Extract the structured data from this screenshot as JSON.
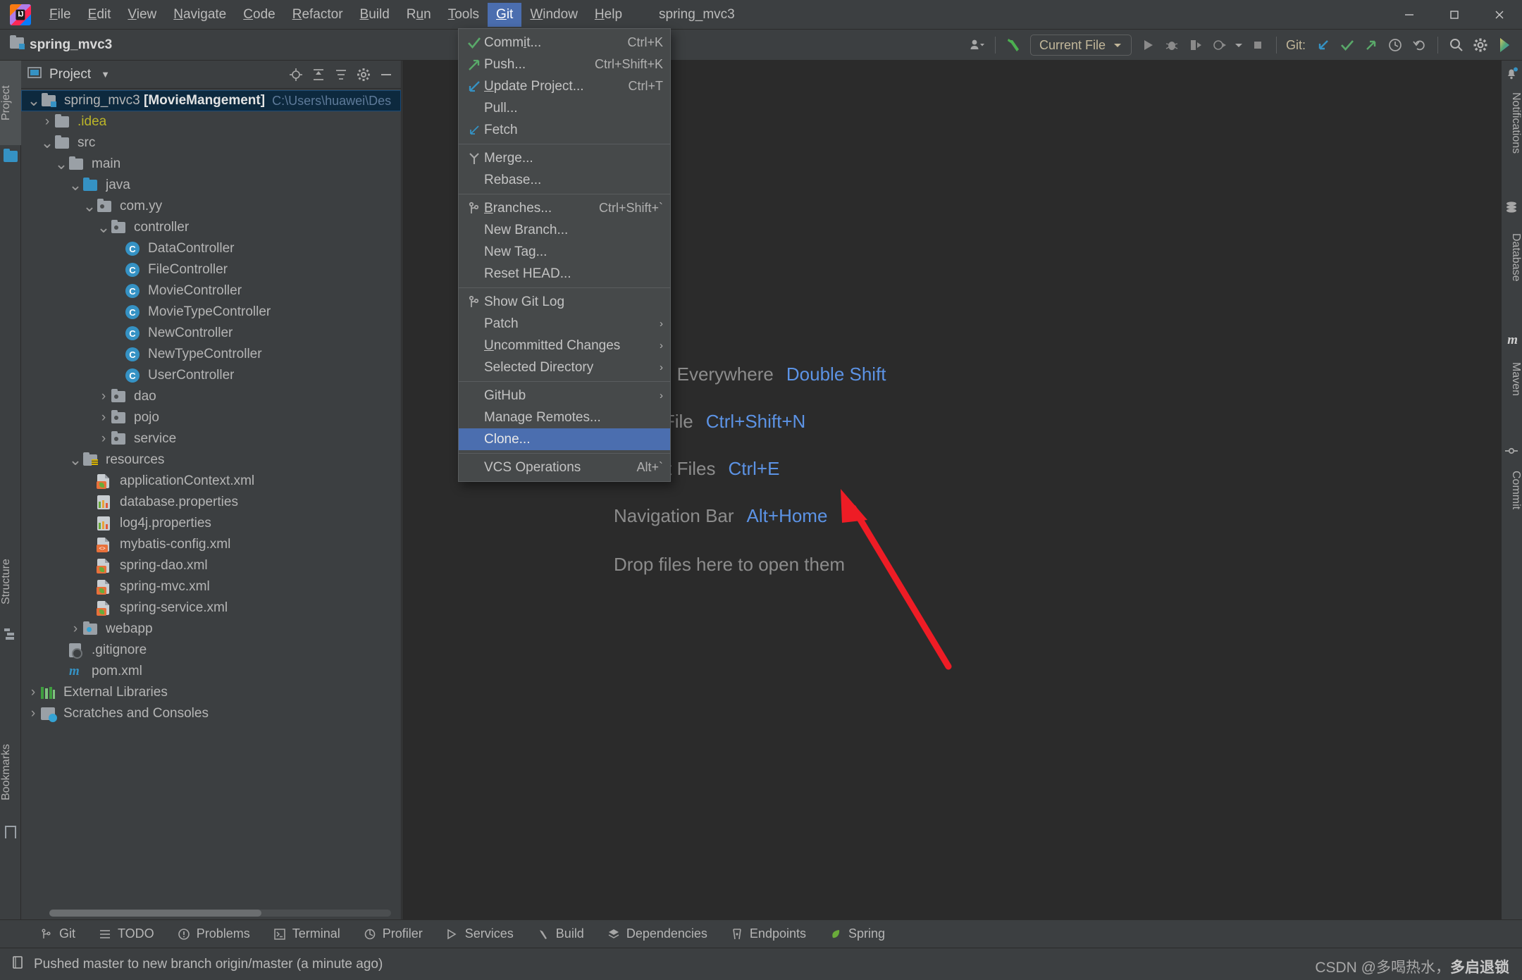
{
  "window": {
    "title": "spring_mvc3",
    "controls": {
      "minimize": "—",
      "maximize": "❐",
      "close": "✕"
    }
  },
  "menubar": {
    "items": [
      {
        "label": "File",
        "mnemonic": "F"
      },
      {
        "label": "Edit",
        "mnemonic": "E"
      },
      {
        "label": "View",
        "mnemonic": "V"
      },
      {
        "label": "Navigate",
        "mnemonic": "N"
      },
      {
        "label": "Code",
        "mnemonic": "C"
      },
      {
        "label": "Refactor",
        "mnemonic": "R"
      },
      {
        "label": "Build",
        "mnemonic": "B"
      },
      {
        "label": "Run",
        "mnemonic": "u"
      },
      {
        "label": "Tools",
        "mnemonic": "T"
      },
      {
        "label": "Git",
        "mnemonic": "G",
        "active": true
      },
      {
        "label": "Window",
        "mnemonic": "W"
      },
      {
        "label": "Help",
        "mnemonic": "H"
      }
    ]
  },
  "navbar": {
    "breadcrumb": "spring_mvc3",
    "run_config": "Current File",
    "git_label": "Git:"
  },
  "git_menu": {
    "items": [
      {
        "label": "Commit...",
        "mnemonic": "i",
        "shortcut": "Ctrl+K",
        "icon": "check-icon"
      },
      {
        "label": "Push...",
        "shortcut": "Ctrl+Shift+K",
        "icon": "arrow-up-right-icon"
      },
      {
        "label": "Update Project...",
        "mnemonic": "U",
        "shortcut": "Ctrl+T",
        "icon": "arrow-down-left-icon"
      },
      {
        "label": "Pull...",
        "shortcut": "",
        "icon": ""
      },
      {
        "label": "Fetch",
        "shortcut": "",
        "icon": "fetch-icon"
      },
      {
        "separator": true
      },
      {
        "label": "Merge...",
        "shortcut": "",
        "icon": "merge-icon"
      },
      {
        "label": "Rebase...",
        "shortcut": "",
        "icon": ""
      },
      {
        "separator": true
      },
      {
        "label": "Branches...",
        "mnemonic": "B",
        "shortcut": "Ctrl+Shift+`",
        "icon": "branch-icon"
      },
      {
        "label": "New Branch...",
        "shortcut": "",
        "icon": ""
      },
      {
        "label": "New Tag...",
        "shortcut": "",
        "icon": ""
      },
      {
        "label": "Reset HEAD...",
        "shortcut": "",
        "icon": ""
      },
      {
        "separator": true
      },
      {
        "label": "Show Git Log",
        "shortcut": "",
        "icon": "branch-icon"
      },
      {
        "label": "Patch",
        "shortcut": "",
        "icon": "",
        "submenu": true
      },
      {
        "label": "Uncommitted Changes",
        "mnemonic": "U",
        "shortcut": "",
        "icon": "",
        "submenu": true
      },
      {
        "label": "Selected Directory",
        "shortcut": "",
        "icon": "",
        "submenu": true
      },
      {
        "separator": true
      },
      {
        "label": "GitHub",
        "shortcut": "",
        "icon": "",
        "submenu": true
      },
      {
        "label": "Manage Remotes...",
        "shortcut": "",
        "icon": ""
      },
      {
        "label": "Clone...",
        "shortcut": "",
        "icon": "",
        "highlighted": true
      },
      {
        "separator": true
      },
      {
        "label": "VCS Operations",
        "shortcut": "Alt+`",
        "icon": ""
      }
    ]
  },
  "project_panel": {
    "title": "Project",
    "tree": [
      {
        "depth": 0,
        "arrow": "down",
        "icon": "module-folder-icon",
        "label": "spring_mvc3 ",
        "bold": "[MovieMangement]",
        "path": "C:\\Users\\huawei\\Des",
        "selected": true
      },
      {
        "depth": 1,
        "arrow": "right",
        "icon": "folder-icon",
        "label": ".idea",
        "yellow": true
      },
      {
        "depth": 1,
        "arrow": "down",
        "icon": "folder-icon",
        "label": "src"
      },
      {
        "depth": 2,
        "arrow": "down",
        "icon": "folder-icon",
        "label": "main"
      },
      {
        "depth": 3,
        "arrow": "down",
        "icon": "source-folder-icon",
        "label": "java"
      },
      {
        "depth": 4,
        "arrow": "down",
        "icon": "package-icon",
        "label": "com.yy"
      },
      {
        "depth": 5,
        "arrow": "down",
        "icon": "package-icon",
        "label": "controller"
      },
      {
        "depth": 6,
        "arrow": "none",
        "icon": "java-class-icon",
        "label": "DataController"
      },
      {
        "depth": 6,
        "arrow": "none",
        "icon": "java-class-icon",
        "label": "FileController"
      },
      {
        "depth": 6,
        "arrow": "none",
        "icon": "java-class-icon",
        "label": "MovieController"
      },
      {
        "depth": 6,
        "arrow": "none",
        "icon": "java-class-icon",
        "label": "MovieTypeController"
      },
      {
        "depth": 6,
        "arrow": "none",
        "icon": "java-class-icon",
        "label": "NewController"
      },
      {
        "depth": 6,
        "arrow": "none",
        "icon": "java-class-icon",
        "label": "NewTypeController"
      },
      {
        "depth": 6,
        "arrow": "none",
        "icon": "java-class-icon",
        "label": "UserController"
      },
      {
        "depth": 5,
        "arrow": "right",
        "icon": "package-icon",
        "label": "dao"
      },
      {
        "depth": 5,
        "arrow": "right",
        "icon": "package-icon",
        "label": "pojo"
      },
      {
        "depth": 5,
        "arrow": "right",
        "icon": "package-icon",
        "label": "service"
      },
      {
        "depth": 3,
        "arrow": "down",
        "icon": "resources-folder-icon",
        "label": "resources"
      },
      {
        "depth": 4,
        "arrow": "none",
        "icon": "spring-xml-icon",
        "label": "applicationContext.xml"
      },
      {
        "depth": 4,
        "arrow": "none",
        "icon": "properties-icon",
        "label": "database.properties"
      },
      {
        "depth": 4,
        "arrow": "none",
        "icon": "properties-icon",
        "label": "log4j.properties"
      },
      {
        "depth": 4,
        "arrow": "none",
        "icon": "xml-icon",
        "label": "mybatis-config.xml"
      },
      {
        "depth": 4,
        "arrow": "none",
        "icon": "spring-xml-icon",
        "label": "spring-dao.xml"
      },
      {
        "depth": 4,
        "arrow": "none",
        "icon": "spring-xml-icon",
        "label": "spring-mvc.xml"
      },
      {
        "depth": 4,
        "arrow": "none",
        "icon": "spring-xml-icon",
        "label": "spring-service.xml"
      },
      {
        "depth": 3,
        "arrow": "right",
        "icon": "webapp-folder-icon",
        "label": "webapp"
      },
      {
        "depth": 2,
        "arrow": "none",
        "icon": "gitignore-icon",
        "label": ".gitignore"
      },
      {
        "depth": 2,
        "arrow": "none",
        "icon": "maven-icon",
        "label": "pom.xml"
      },
      {
        "depth": 0,
        "arrow": "right",
        "icon": "libraries-icon",
        "label": "External Libraries"
      },
      {
        "depth": 0,
        "arrow": "right",
        "icon": "scratches-icon",
        "label": "Scratches and Consoles"
      }
    ]
  },
  "left_strip": {
    "tabs": [
      {
        "label": "Project",
        "selected": true
      },
      {
        "label": "Structure",
        "selected": false
      },
      {
        "label": "Bookmarks",
        "selected": false
      }
    ]
  },
  "right_strip": {
    "tabs": [
      {
        "label": "Notifications",
        "icon": "bell-icon"
      },
      {
        "label": "Database",
        "icon": "database-icon"
      },
      {
        "label": "Maven",
        "icon": "maven-icon"
      },
      {
        "label": "Commit",
        "icon": "commit-icon"
      }
    ]
  },
  "editor": {
    "hints": [
      {
        "text": "Search Everywhere",
        "key": "Double Shift"
      },
      {
        "text": "Go to File",
        "key": "Ctrl+Shift+N"
      },
      {
        "text": "Recent Files",
        "key": "Ctrl+E"
      },
      {
        "text": "Navigation Bar",
        "key": "Alt+Home"
      }
    ],
    "drop_text": "Drop files here to open them"
  },
  "bottom_bar": {
    "tools": [
      {
        "label": "Git",
        "icon": "branch-icon"
      },
      {
        "label": "TODO",
        "icon": "list-icon"
      },
      {
        "label": "Problems",
        "icon": "warning-icon"
      },
      {
        "label": "Terminal",
        "icon": "terminal-icon"
      },
      {
        "label": "Profiler",
        "icon": "profiler-icon"
      },
      {
        "label": "Services",
        "icon": "services-icon"
      },
      {
        "label": "Build",
        "icon": "hammer-icon"
      },
      {
        "label": "Dependencies",
        "icon": "layers-icon"
      },
      {
        "label": "Endpoints",
        "icon": "endpoints-icon"
      },
      {
        "label": "Spring",
        "icon": "spring-leaf-icon"
      }
    ]
  },
  "status_bar": {
    "message": "Pushed master to new branch origin/master (a minute ago)",
    "watermark_prefix": "CSDN @多喝热水，",
    "watermark_strong": "多启退锁"
  },
  "colors": {
    "accent_blue": "#4b6eaf",
    "selection_blue": "#0d293e",
    "link_blue": "#5c93e5",
    "bg_panel": "#3c3f41",
    "bg_editor": "#2b2b2b",
    "green": "#59a869",
    "red_arrow": "#ee1c25"
  }
}
